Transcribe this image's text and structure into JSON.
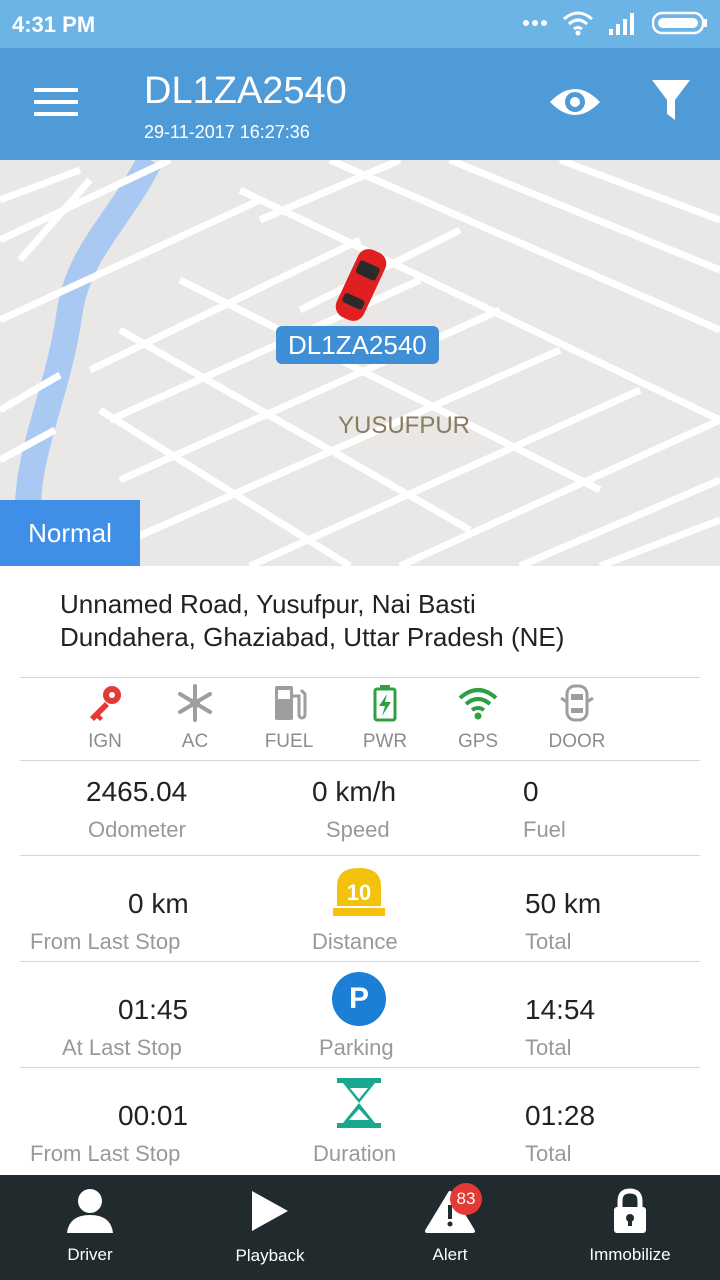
{
  "status_bar": {
    "time": "4:31 PM"
  },
  "app_bar": {
    "title": "DL1ZA2540",
    "subtitle": "29-11-2017 16:27:36",
    "menu_icon": "menu-icon",
    "eye_icon": "eye-icon",
    "filter_icon": "filter-icon"
  },
  "map": {
    "vehicle_plate": "DL1ZA2540",
    "place_label": "YUSUFPUR",
    "status_tag": "Normal"
  },
  "address": {
    "line1": "Unnamed Road, Yusufpur, Nai Basti",
    "line2": "Dundahera, Ghaziabad, Uttar Pradesh (NE)"
  },
  "indicators": [
    {
      "label": "IGN",
      "icon": "key-icon",
      "color": "#e53935"
    },
    {
      "label": "AC",
      "icon": "snowflake-icon",
      "color": "#9e9e9e"
    },
    {
      "label": "FUEL",
      "icon": "fuel-pump-icon",
      "color": "#9e9e9e"
    },
    {
      "label": "PWR",
      "icon": "battery-icon",
      "color": "#2ea043"
    },
    {
      "label": "GPS",
      "icon": "wifi-icon",
      "color": "#2ea043"
    },
    {
      "label": "DOOR",
      "icon": "car-door-icon",
      "color": "#9e9e9e"
    }
  ],
  "stats": {
    "odometer": {
      "value": "2465.04",
      "label": "Odometer"
    },
    "speed": {
      "value": "0 km/h",
      "label": "Speed"
    },
    "fuel": {
      "value": "0",
      "label": "Fuel"
    },
    "distance": {
      "from_last_stop": "0 km",
      "from_last_stop_label": "From Last Stop",
      "icon_text": "10",
      "label": "Distance",
      "total": "50 km",
      "total_label": "Total"
    },
    "parking": {
      "at_last_stop": "01:45",
      "at_last_stop_label": "At Last Stop",
      "icon_text": "P",
      "label": "Parking",
      "total": "14:54",
      "total_label": "Total"
    },
    "duration": {
      "from_last_stop": "00:01",
      "from_last_stop_label": "From Last Stop",
      "label": "Duration",
      "total": "01:28",
      "total_label": "Total"
    }
  },
  "bottom_nav": [
    {
      "label": "Driver",
      "icon": "person-icon"
    },
    {
      "label": "Playback",
      "icon": "play-icon"
    },
    {
      "label": "Alert",
      "icon": "alert-icon",
      "badge": "83"
    },
    {
      "label": "Immobilize",
      "icon": "lock-icon"
    }
  ],
  "colors": {
    "app_bar": "#4f9bd8",
    "status_bar": "#6cb3e6",
    "tag": "#3f8fe9",
    "bottom_bar": "#212a2d",
    "badge": "#e53935"
  }
}
